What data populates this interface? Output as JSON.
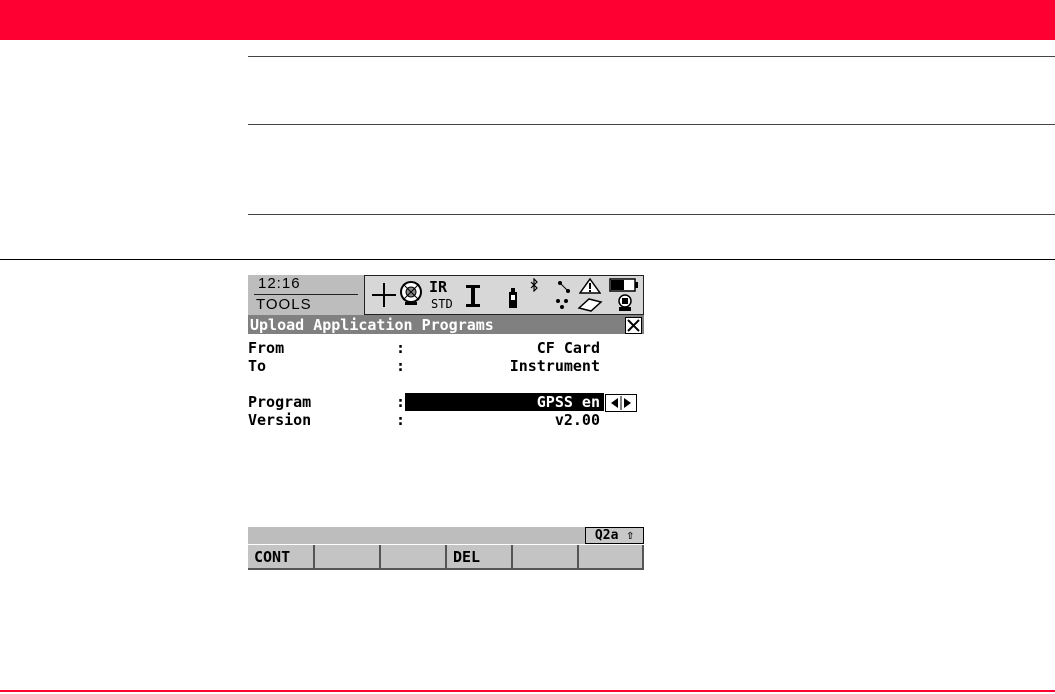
{
  "status_bar": {
    "time": "12:16",
    "mode": "TOOLS",
    "icons": [
      "crosshair-icon",
      "prism-icon",
      "ir-std-label-icon",
      "cursor-i-icon",
      "battery-cell-icon",
      "bluetooth-icon",
      "link-icon",
      "warning-icon",
      "card-icon",
      "battery-icon",
      "instrument-icon"
    ],
    "ir_label": "IR",
    "std_label": "STD"
  },
  "dialog": {
    "title": "Upload Application Programs",
    "fields": [
      {
        "label": "From",
        "value": "CF Card"
      },
      {
        "label": "To",
        "value": "Instrument"
      },
      {
        "label": "Program",
        "value": "GPSS en"
      },
      {
        "label": "Version",
        "value": "v2.00"
      }
    ],
    "colon": ":"
  },
  "softkeys": {
    "input_mode": "Q2a ⇧",
    "keys": [
      {
        "label": "CONT"
      },
      {
        "label": ""
      },
      {
        "label": ""
      },
      {
        "label": "DEL"
      },
      {
        "label": ""
      },
      {
        "label": ""
      }
    ]
  },
  "colors": {
    "brand_red": "#ff0033",
    "title_bar": "#808080",
    "status_gray": "#bdbdbd"
  }
}
